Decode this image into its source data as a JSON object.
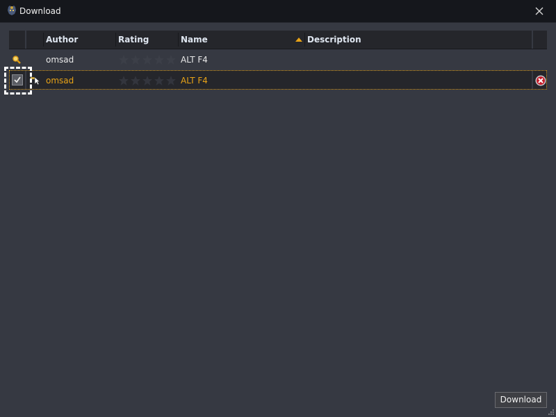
{
  "window": {
    "title": "Download",
    "app_icon": "app-logo-icon",
    "close_icon": "close-icon"
  },
  "table": {
    "columns": [
      {
        "label": ""
      },
      {
        "label": ""
      },
      {
        "label": "Author"
      },
      {
        "label": "Rating"
      },
      {
        "label": "Name",
        "sort": "ascending"
      },
      {
        "label": "Description"
      },
      {
        "label": ""
      }
    ],
    "rows": [
      {
        "icon": "search-icon",
        "author": "omsad",
        "rating": 0,
        "rating_max": 5,
        "name": "ALT F4",
        "description": "",
        "checked": null
      },
      {
        "icon": "cursor-icon",
        "author": "omsad",
        "rating": 0,
        "rating_max": 5,
        "name": "ALT F4",
        "description": "",
        "checked": true,
        "selected": true,
        "remove_icon": "remove-icon"
      }
    ]
  },
  "footer": {
    "download_label": "Download"
  },
  "colors": {
    "accent": "#e8a317",
    "background": "#363942",
    "titlebar": "#15171c"
  }
}
